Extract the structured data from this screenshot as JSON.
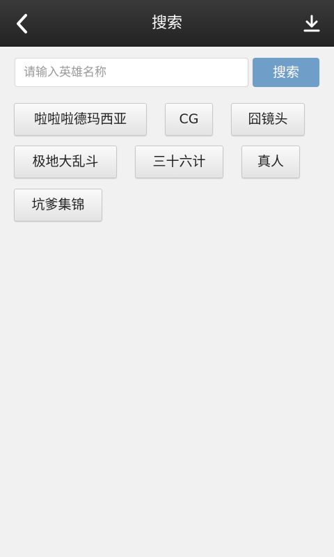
{
  "header": {
    "title": "搜索",
    "back_icon": "chevron-left-icon",
    "download_icon": "download-icon"
  },
  "search": {
    "placeholder": "请输入英雄名称",
    "value": "",
    "button_label": "搜索"
  },
  "tags": [
    {
      "label": "啦啦啦德玛西亚"
    },
    {
      "label": "CG"
    },
    {
      "label": "囧镜头"
    },
    {
      "label": "极地大乱斗"
    },
    {
      "label": "三十六计"
    },
    {
      "label": "真人"
    },
    {
      "label": "坑爹集锦"
    }
  ],
  "colors": {
    "topbar": "#2e2e2e",
    "background": "#f1f1f1",
    "search_button": "#6f9ec9"
  }
}
